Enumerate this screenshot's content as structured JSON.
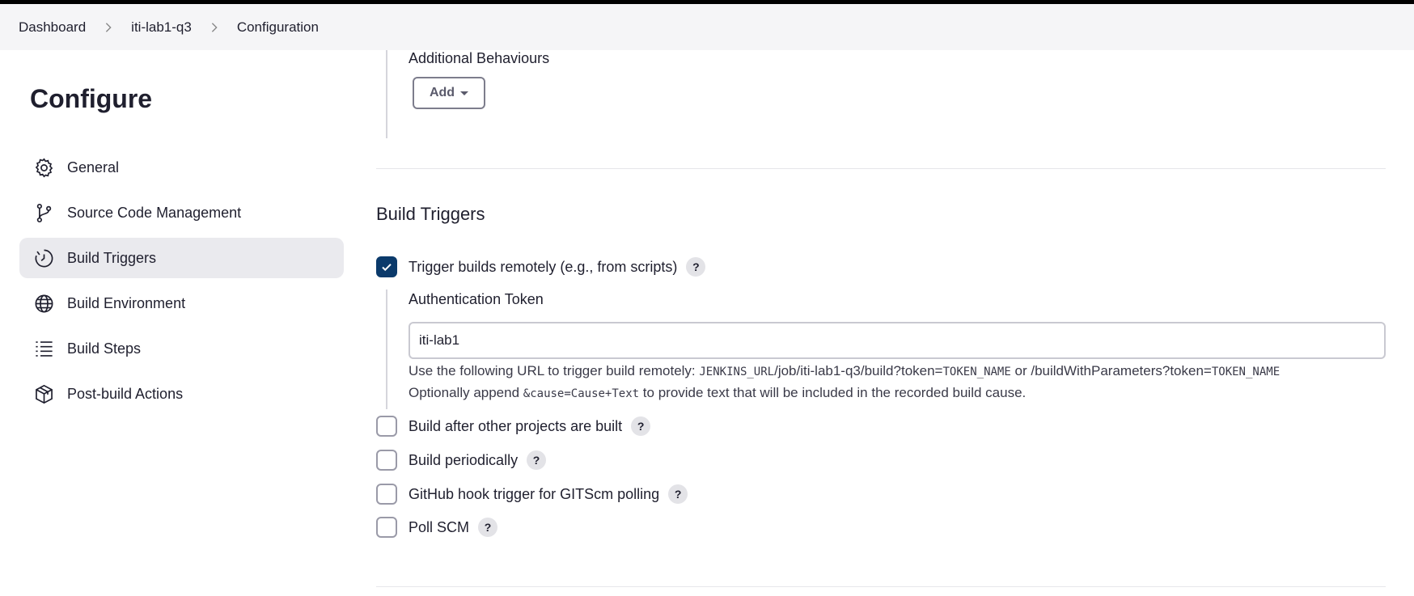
{
  "breadcrumb": {
    "items": [
      "Dashboard",
      "iti-lab1-q3",
      "Configuration"
    ]
  },
  "sidebar": {
    "title": "Configure",
    "items": [
      {
        "label": "General",
        "icon": "gear-icon"
      },
      {
        "label": "Source Code Management",
        "icon": "branch-icon"
      },
      {
        "label": "Build Triggers",
        "icon": "clock-icon",
        "active": true
      },
      {
        "label": "Build Environment",
        "icon": "globe-icon"
      },
      {
        "label": "Build Steps",
        "icon": "list-icon"
      },
      {
        "label": "Post-build Actions",
        "icon": "package-icon"
      }
    ]
  },
  "additional_behaviours": {
    "title": "Additional Behaviours",
    "add_label": "Add"
  },
  "build_triggers": {
    "title": "Build Triggers",
    "remote": {
      "label": "Trigger builds remotely (e.g., from scripts)",
      "checked": true,
      "token_label": "Authentication Token",
      "token_value": "iti-lab1",
      "help_line1_prefix": "Use the following URL to trigger build remotely: ",
      "help_line1_code1": "JENKINS_URL",
      "help_line1_mid": "/job/iti-lab1-q3/build?token=",
      "help_line1_code2": "TOKEN_NAME",
      "help_line1_mid2": " or /buildWithParameters?token=",
      "help_line1_code3": "TOKEN_NAME",
      "help_line2_prefix": "Optionally append ",
      "help_line2_code": "&cause=Cause+Text",
      "help_line2_suffix": " to provide text that will be included in the recorded build cause."
    },
    "options": [
      {
        "label": "Build after other projects are built",
        "checked": false
      },
      {
        "label": "Build periodically",
        "checked": false
      },
      {
        "label": "GitHub hook trigger for GITScm polling",
        "checked": false
      },
      {
        "label": "Poll SCM",
        "checked": false
      }
    ],
    "help_symbol": "?"
  },
  "colors": {
    "accent": "#0b3a6b",
    "breadcrumb_bg": "#f5f5f7",
    "active_nav_bg": "#eaeaee"
  }
}
